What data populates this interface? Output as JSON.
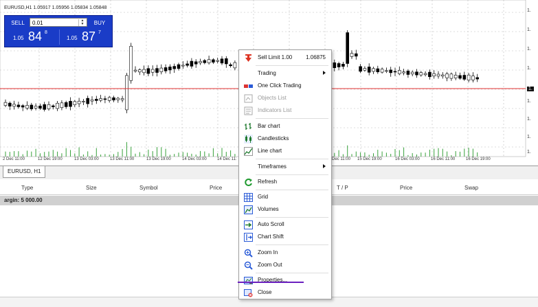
{
  "chart": {
    "symbol_info": "EURUSD,H1  1.05917 1.05956 1.05834 1.05848",
    "x_labels": [
      "2 Dec 11:00",
      "12 Dec 19:00",
      "13 Dec 03:00",
      "13 Dec 11:00",
      "13 Dec 19:00",
      "14 Dec 03:00",
      "14 Dec 11:",
      "Dec 11:00",
      "15 Dec 19:00",
      "16 Dec 03:00",
      "16 Dec 11:00",
      "16 Dec 19:00"
    ],
    "scale_labels": [
      "1.",
      "1.",
      "1.",
      "1.",
      "1.",
      "1.",
      "1.",
      "1.",
      "1."
    ],
    "bid_line_color": "#e03030"
  },
  "trade_panel": {
    "sell_label": "SELL",
    "buy_label": "BUY",
    "lot_value": "0.01",
    "sell_prefix": "1.05",
    "sell_big": "84",
    "sell_sup": "8",
    "buy_prefix": "1.05",
    "buy_big": "87",
    "buy_sup": "7"
  },
  "tabs": {
    "active": "EURUSD, H1"
  },
  "table": {
    "headers": {
      "type": "Type",
      "size": "Size",
      "symbol": "Symbol",
      "price": "Price",
      "tp": "T / P",
      "price2": "Price",
      "swap": "Swap"
    },
    "margin_text": "argin: 5 000.00"
  },
  "context_menu": {
    "sell_limit": "Sell Limit 1.00",
    "sell_limit_price": "1.06875",
    "trading": "Trading",
    "one_click": "One Click Trading",
    "objects_list": "Objects List",
    "indicators_list": "Indicators List",
    "bar_chart": "Bar chart",
    "candlesticks": "Candlesticks",
    "line_chart": "Line chart",
    "timeframes": "Timeframes",
    "refresh": "Refresh",
    "grid": "Grid",
    "volumes": "Volumes",
    "auto_scroll": "Auto Scroll",
    "chart_shift": "Chart Shift",
    "zoom_in": "Zoom In",
    "zoom_out": "Zoom Out",
    "properties": "Properties...",
    "close": "Close"
  },
  "colors": {
    "panel_blue": "#1a3cc7",
    "highlight_underline": "#6a1fbf"
  }
}
